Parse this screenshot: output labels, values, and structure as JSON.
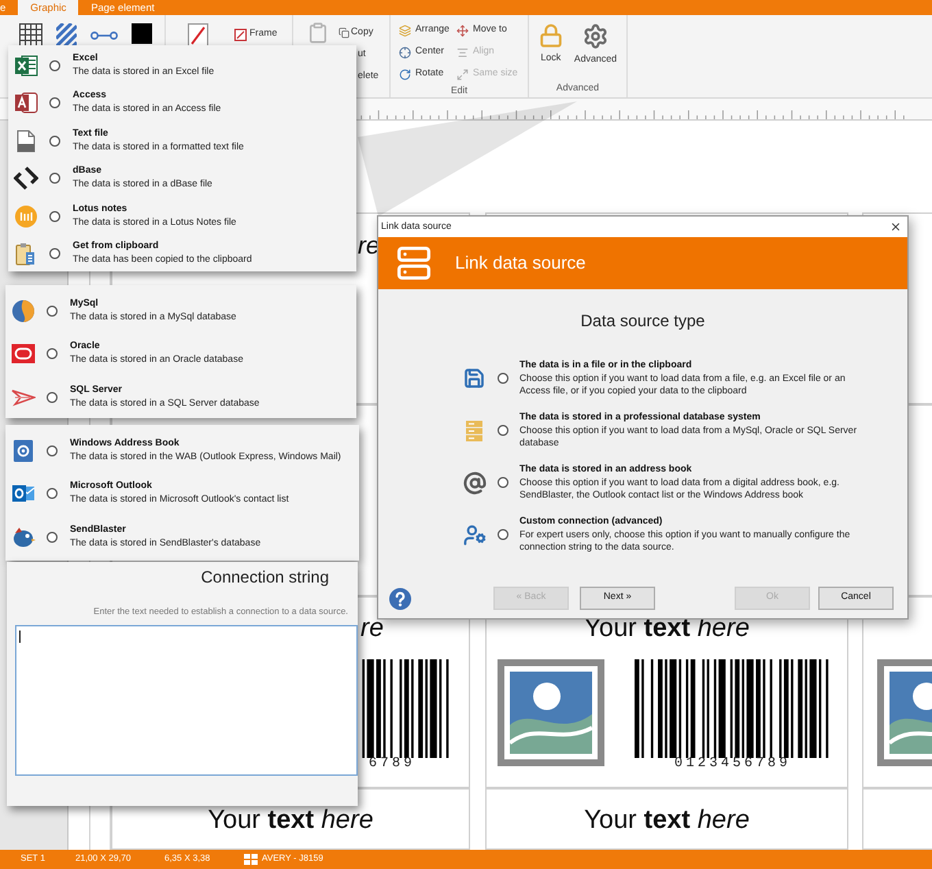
{
  "tabs": [
    {
      "label": "e",
      "selected": false
    },
    {
      "label": "Graphic",
      "selected": true
    },
    {
      "label": "Page element",
      "selected": false
    }
  ],
  "ribbon": {
    "frame_label": "Frame",
    "clipboard_items": [
      {
        "label": "Copy"
      },
      {
        "label": "ut"
      },
      {
        "label": "elete"
      }
    ],
    "edit_group": {
      "label": "Edit",
      "items": [
        {
          "label": "Arrange",
          "disabled": false
        },
        {
          "label": "Move to",
          "disabled": false
        },
        {
          "label": "Center",
          "disabled": false
        },
        {
          "label": "Align",
          "disabled": true
        },
        {
          "label": "Rotate",
          "disabled": false
        },
        {
          "label": "Same size",
          "disabled": true
        }
      ]
    },
    "advanced_group": {
      "label": "Advanced",
      "items": [
        {
          "label": "Lock"
        },
        {
          "label": "Advanced"
        }
      ]
    }
  },
  "file_sources": [
    {
      "title": "Excel",
      "description": "The data is stored in an Excel file",
      "selected": false
    },
    {
      "title": "Access",
      "description": "The data is stored in an Access file",
      "selected": false
    },
    {
      "title": "Text file",
      "description": "The data is stored in a formatted text file",
      "selected": false
    },
    {
      "title": "dBase",
      "description": "The data is stored in a dBase file",
      "selected": false
    },
    {
      "title": "Lotus notes",
      "description": "The data is stored in a Lotus Notes file",
      "selected": false
    },
    {
      "title": "Get from clipboard",
      "description": "The data has been copied to the clipboard",
      "selected": false
    }
  ],
  "database_sources": [
    {
      "title": "MySql",
      "description": "The data is stored in a MySql database",
      "selected": false
    },
    {
      "title": "Oracle",
      "description": "The data is stored in an Oracle database",
      "selected": false
    },
    {
      "title": "SQL Server",
      "description": "The data is stored in a SQL Server database",
      "selected": false
    }
  ],
  "address_book_sources": [
    {
      "title": "Windows Address Book",
      "description": "The data is stored in the WAB (Outlook Express, Windows Mail)",
      "selected": false
    },
    {
      "title": "Microsoft Outlook",
      "description": "The data is stored in Microsoft Outlook's contact list",
      "selected": false
    },
    {
      "title": "SendBlaster",
      "description": "The data is stored in SendBlaster's database",
      "selected": false
    }
  ],
  "connection_string": {
    "title": "Connection string",
    "hint": "Enter the text needed to establish a connection to a data source."
  },
  "dialog": {
    "title": "Link data source",
    "header": "Link data source",
    "heading": "Data source type",
    "options": [
      {
        "title": "The data is in a file or in the clipboard",
        "description": "Choose this option if you want to load data from a file, e.g. an Excel file or an Access file, or if you copied your data to the clipboard",
        "selected": false
      },
      {
        "title": "The data is stored in a professional database system",
        "description": "Choose this option if you want to load data from a MySql, Oracle or SQL Server database",
        "selected": false
      },
      {
        "title": "The data is stored in an address book",
        "description": "Choose this option if you want to load data from a digital address book, e.g. SendBlaster, the Outlook contact list or the Windows Address book",
        "selected": false
      },
      {
        "title": "Custom connection (advanced)",
        "description": "For expert users only, choose this option if you want to manually configure the connection string to the data source.",
        "selected": false
      }
    ],
    "buttons": [
      {
        "label": "« Back",
        "disabled": true
      },
      {
        "label": "Next »",
        "disabled": false
      },
      {
        "label": "Ok",
        "disabled": true
      },
      {
        "label": "Cancel",
        "disabled": false
      }
    ]
  },
  "canvas": {
    "upper_left_caption": "re",
    "middle_row": [
      {
        "kind": "tail",
        "caption": "re",
        "digits": "6789"
      },
      {
        "kind": "full",
        "caption": "Your **text** *here*",
        "digits": "0123456789"
      },
      {
        "kind": "picture"
      }
    ],
    "bottom_row": [
      {
        "caption": "Your **text** *here*"
      },
      {
        "caption": "Your **text** *here*"
      }
    ]
  },
  "status_bar": {
    "set": "SET 1",
    "page_size": "21,00 X 29,70",
    "label_size": "6,35 X 3,38",
    "template": "AVERY - J8159"
  }
}
